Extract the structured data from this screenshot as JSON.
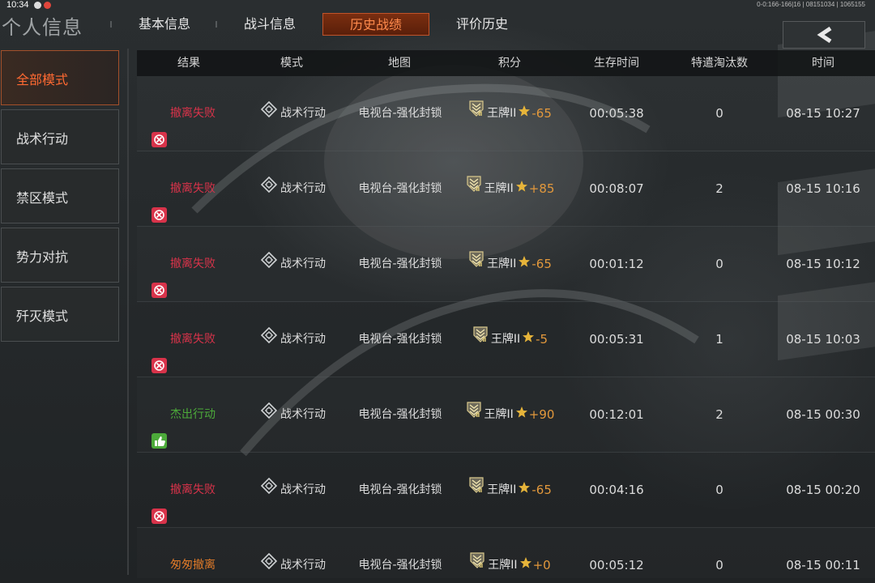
{
  "status": {
    "time": "10:34",
    "right_text": "0-0:166-166|16 | 08151034 | 1065155"
  },
  "header": {
    "title": "个人信息",
    "tabs": [
      {
        "label": "基本信息",
        "active": false
      },
      {
        "label": "战斗信息",
        "active": false
      },
      {
        "label": "历史战绩",
        "active": true
      },
      {
        "label": "评价历史",
        "active": false
      }
    ]
  },
  "sidebar": {
    "items": [
      {
        "label": "全部模式",
        "active": true
      },
      {
        "label": "战术行动",
        "active": false
      },
      {
        "label": "禁区模式",
        "active": false
      },
      {
        "label": "势力对抗",
        "active": false
      },
      {
        "label": "歼灭模式",
        "active": false
      }
    ]
  },
  "table": {
    "columns": [
      "结果",
      "模式",
      "地图",
      "积分",
      "生存时间",
      "特遣淘汰数",
      "时间"
    ],
    "rows": [
      {
        "result": "撤离失败",
        "result_type": "fail",
        "mode": "战术行动",
        "map": "电视台-强化封锁",
        "rank": "王牌II",
        "delta": "-65",
        "survive": "00:05:38",
        "kills": "0",
        "time": "08-15 10:27"
      },
      {
        "result": "撤离失败",
        "result_type": "fail",
        "mode": "战术行动",
        "map": "电视台-强化封锁",
        "rank": "王牌II",
        "delta": "+85",
        "survive": "00:08:07",
        "kills": "2",
        "time": "08-15 10:16"
      },
      {
        "result": "撤离失败",
        "result_type": "fail",
        "mode": "战术行动",
        "map": "电视台-强化封锁",
        "rank": "王牌II",
        "delta": "-65",
        "survive": "00:01:12",
        "kills": "0",
        "time": "08-15 10:12"
      },
      {
        "result": "撤离失败",
        "result_type": "fail",
        "mode": "战术行动",
        "map": "电视台-强化封锁",
        "rank": "王牌II",
        "delta": "-5",
        "survive": "00:05:31",
        "kills": "1",
        "time": "08-15 10:03"
      },
      {
        "result": "杰出行动",
        "result_type": "excellent",
        "mode": "战术行动",
        "map": "电视台-强化封锁",
        "rank": "王牌II",
        "delta": "+90",
        "survive": "00:12:01",
        "kills": "2",
        "time": "08-15 00:30"
      },
      {
        "result": "撤离失败",
        "result_type": "fail",
        "mode": "战术行动",
        "map": "电视台-强化封锁",
        "rank": "王牌II",
        "delta": "-65",
        "survive": "00:04:16",
        "kills": "0",
        "time": "08-15 00:20"
      },
      {
        "result": "匆匆撤离",
        "result_type": "hasty",
        "mode": "战术行动",
        "map": "电视台-强化封锁",
        "rank": "王牌II",
        "delta": "+0",
        "survive": "00:05:12",
        "kills": "0",
        "time": "08-15 00:11"
      }
    ]
  },
  "colors": {
    "fail": "#d8334a",
    "excellent": "#4caa3a",
    "hasty": "#e07a28",
    "accent": "#ff6a32",
    "score_delta": "#e2983c"
  },
  "icons": {
    "back": "chevron-left-icon",
    "fail": "fail-extraction-icon",
    "excellent": "thumbs-up-icon",
    "hasty": "warning-icon",
    "mode": "tactical-operation-icon",
    "rank": "ace-rank-icon",
    "star": "star-icon"
  }
}
